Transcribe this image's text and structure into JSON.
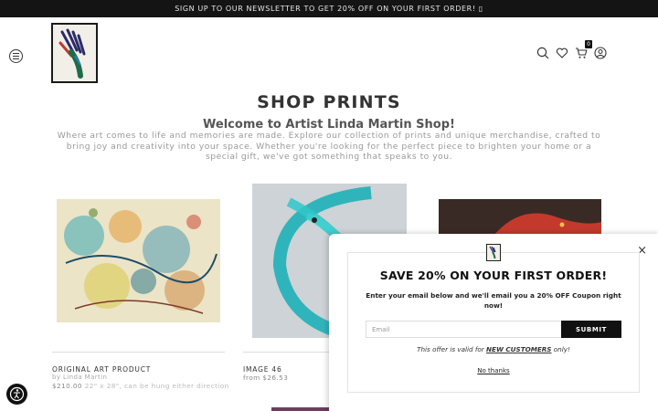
{
  "announcement": {
    "text": "SIGN UP TO OUR NEWSLETTER TO GET 20% OFF ON YOUR FIRST ORDER! ▯"
  },
  "header": {
    "cart_count": "0",
    "icons": [
      "menu-icon",
      "search-icon",
      "heart-icon",
      "cart-icon",
      "account-icon"
    ]
  },
  "main": {
    "title": "SHOP PRINTS",
    "welcome": "Welcome to Artist Linda Martin Shop!",
    "intro": "Where art comes to life and memories are made. Explore our collection of prints and unique merchandise, crafted to bring joy and creativity into your space. Whether you're looking for the perfect piece to brighten your home or a special gift, we've got something that speaks to you."
  },
  "products": [
    {
      "name": "ORIGINAL ART PRODUCT",
      "by": "by Linda Martin",
      "price": "$210.00",
      "note": "22\" x 28\", can be hung either direction"
    },
    {
      "name": "IMAGE 46",
      "price": "from $26.53"
    }
  ],
  "popup": {
    "title": "SAVE 20% ON YOUR FIRST ORDER!",
    "description": "Enter your email below and we'll email you a 20% OFF Coupon right now!",
    "email_placeholder": "Email",
    "submit_label": "SUBMIT",
    "offer_prefix": "This offer is valid for",
    "offer_highlight": "NEW CUSTOMERS",
    "offer_suffix": "only!",
    "no_thanks": "No thanks",
    "close_label": "×"
  },
  "colors": {
    "announcement_bg": "#141414",
    "button_bg": "#111111",
    "text": "#333333"
  }
}
